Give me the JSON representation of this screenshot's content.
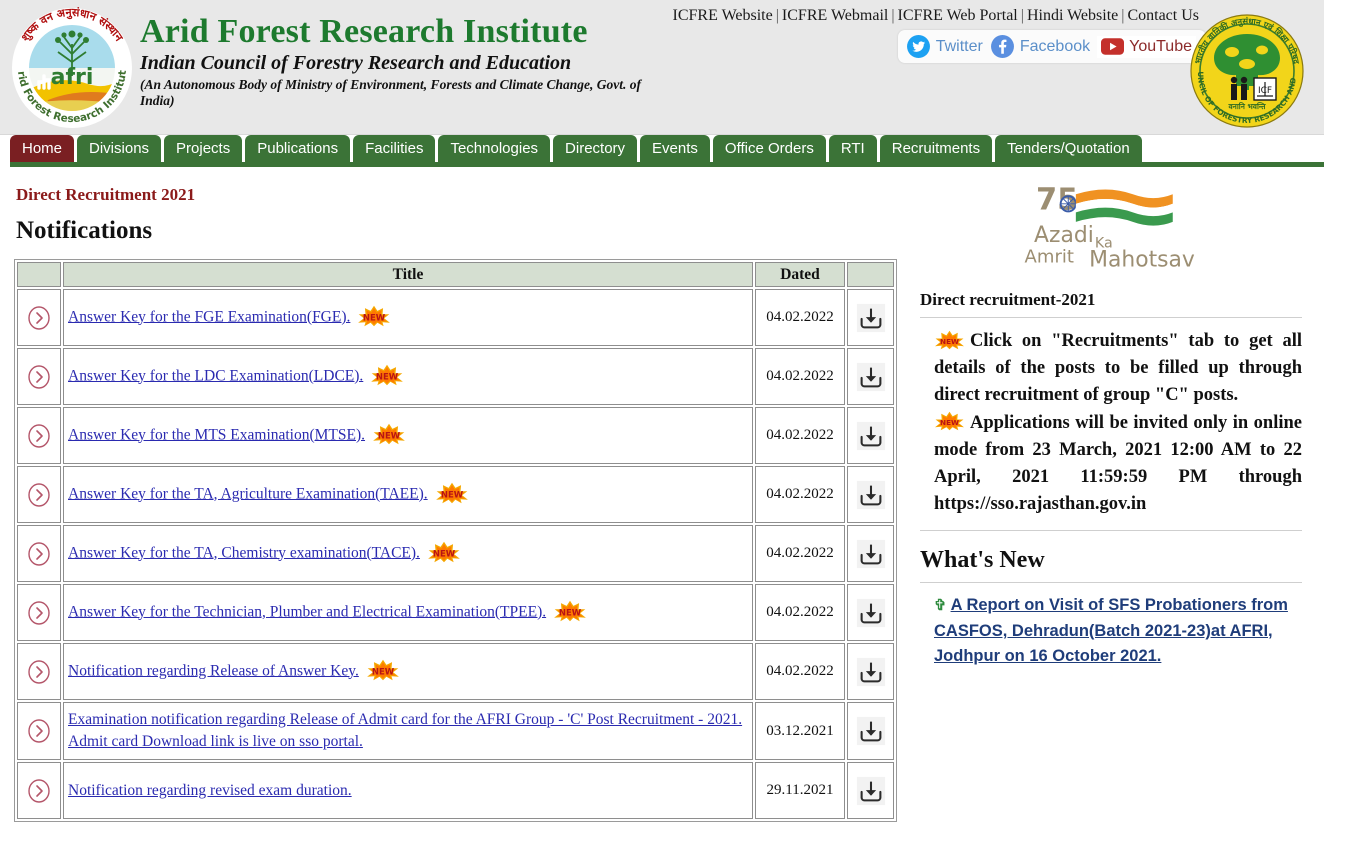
{
  "header": {
    "institute_name": "Arid Forest Research Institute",
    "council_line": "Indian Council of Forestry Research and Education",
    "autonomous_line": "(An Autonomous Body of Ministry of Environment, Forests and Climate Change, Govt. of India)",
    "afri_logo_name": "afri-logo",
    "icfre_logo_name": "icfre-logo",
    "top_links": [
      {
        "label": "ICFRE Website"
      },
      {
        "label": "ICFRE Webmail"
      },
      {
        "label": "ICFRE Web Portal"
      },
      {
        "label": "Hindi Website"
      },
      {
        "label": "Contact Us"
      }
    ],
    "separator": "|",
    "social": [
      {
        "label": "Twitter",
        "icon": "twitter-icon",
        "color": "#1da1f2"
      },
      {
        "label": "Facebook",
        "icon": "facebook-icon",
        "color": "#4267b2"
      },
      {
        "label": "YouTube",
        "icon": "youtube-icon",
        "color": "#c4302b"
      }
    ]
  },
  "nav": {
    "items": [
      {
        "label": "Home",
        "active": true
      },
      {
        "label": "Divisions",
        "active": false
      },
      {
        "label": "Projects",
        "active": false
      },
      {
        "label": "Publications",
        "active": false
      },
      {
        "label": "Facilities",
        "active": false
      },
      {
        "label": "Technologies",
        "active": false
      },
      {
        "label": "Directory",
        "active": false
      },
      {
        "label": "Events",
        "active": false
      },
      {
        "label": "Office Orders",
        "active": false
      },
      {
        "label": "RTI",
        "active": false
      },
      {
        "label": "Recruitments",
        "active": false
      },
      {
        "label": "Tenders/Quotation",
        "active": false
      }
    ],
    "active_color": "#7a1f22",
    "item_color": "#3b7337"
  },
  "main": {
    "section_title": "Direct Recruitment 2021",
    "notifications_heading": "Notifications",
    "table": {
      "columns": [
        "",
        "Title",
        "Dated",
        ""
      ],
      "rows": [
        {
          "title": "Answer Key for the FGE Examination(FGE).",
          "date": "04.02.2022",
          "is_new": true
        },
        {
          "title": "Answer Key for the LDC Examination(LDCE).",
          "date": "04.02.2022",
          "is_new": true
        },
        {
          "title": "Answer Key for the MTS Examination(MTSE).",
          "date": "04.02.2022",
          "is_new": true
        },
        {
          "title": "Answer Key for the TA, Agriculture Examination(TAEE).",
          "date": "04.02.2022",
          "is_new": true
        },
        {
          "title": "Answer Key for the TA, Chemistry examination(TACE).",
          "date": "04.02.2022",
          "is_new": true
        },
        {
          "title": "Answer Key for the Technician, Plumber and Electrical Examination(TPEE).",
          "date": "04.02.2022",
          "is_new": true
        },
        {
          "title": "Notification regarding Release of Answer Key.",
          "date": "04.02.2022",
          "is_new": true
        },
        {
          "title": "Examination notification regarding Release of Admit card for the AFRI Group - 'C' Post Recruitment - 2021. Admit card Download link is live on sso portal.",
          "date": "03.12.2021",
          "is_new": false
        },
        {
          "title": "Notification regarding revised exam duration.",
          "date": "29.11.2021",
          "is_new": false
        }
      ],
      "new_badge_label": "NEW",
      "download_icon": "download-icon",
      "row_arrow_icon": "chevron-right-circle-icon"
    }
  },
  "sidebar": {
    "azadi_logo_alt": "Azadi Ka Amrit Mahotsav",
    "azadi_text_1": "Azadi",
    "azadi_text_2": "Ka",
    "azadi_text_3": "Amrit",
    "azadi_text_4": "Mahotsav",
    "azadi_75": "75",
    "recruitment_title": "Direct recruitment-2021",
    "notice_1": "Click on \"Recruitments\" tab to get all details of the posts to be filled up through direct recruitment of group \"C\" posts.",
    "notice_2": "Applications will be invited only in online mode from 23 March, 2021 12:00 AM to 22 April, 2021 11:59:59 PM                through https://sso.rajasthan.gov.in",
    "whats_new_title": "What's New",
    "whats_new_items": [
      {
        "label": "A Report on Visit of SFS Probationers from CASFOS, Dehradun(Batch 2021-23)at AFRI, Jodhpur on 16 October 2021."
      }
    ]
  },
  "colors": {
    "brand_green": "#1d7a2e",
    "nav_green": "#3b7337",
    "nav_active": "#7a1f22",
    "table_header_bg": "#d5dfd1",
    "link_blue": "#2a2ab0",
    "section_title_red": "#8b1a1a",
    "header_bg": "#e8e8e8"
  }
}
